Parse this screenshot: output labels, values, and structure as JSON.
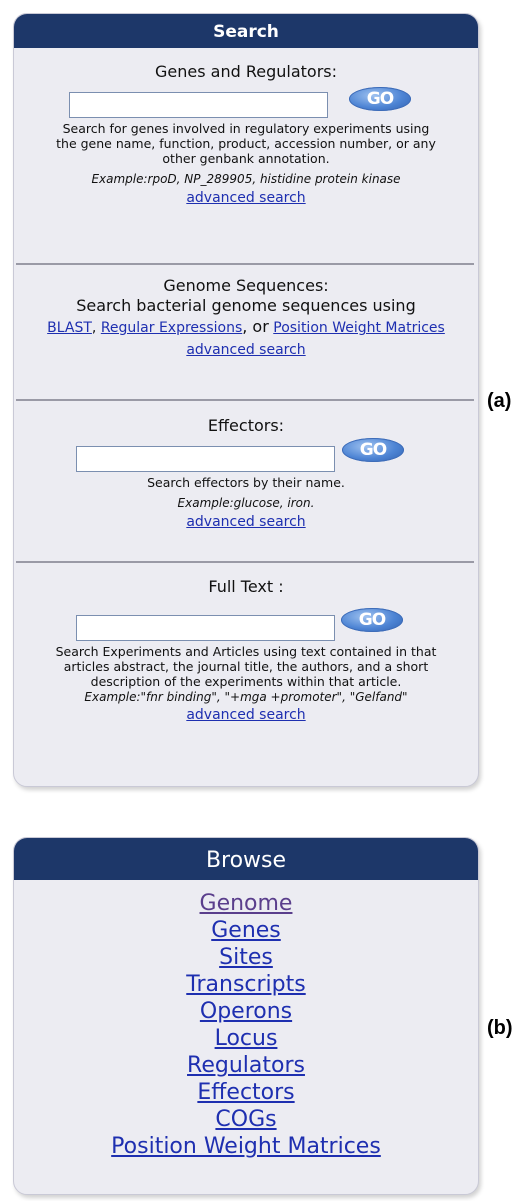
{
  "search": {
    "header": "Search",
    "genes": {
      "title": "Genes and Regulators:",
      "go": "GO",
      "description": "Search for genes involved in regulatory experiments using the gene name, function, product, accession number, or any other genbank annotation.",
      "example": "Example:rpoD, NP_289905, histidine protein kinase",
      "advanced": "advanced search"
    },
    "genome": {
      "title": "Genome Sequences:",
      "intro": "Search bacterial genome sequences using",
      "blast": "BLAST",
      "comma": ",",
      "regex": "Regular Expressions",
      "or": ", or",
      "pwm": "Position Weight Matrices",
      "advanced": "advanced search"
    },
    "effectors": {
      "title": "Effectors:",
      "go": "GO",
      "description": "Search effectors by their name.",
      "example": "Example:glucose, iron.",
      "advanced": "advanced search"
    },
    "fulltext": {
      "title": "Full Text :",
      "go": "GO",
      "description": "Search Experiments and Articles using text contained in that articles abstract, the journal title, the authors, and a short description of the experiments within that article.",
      "example": "Example:\"fnr binding\", \"+mga +promoter\", \"Gelfand\"",
      "advanced": "advanced search"
    }
  },
  "browse": {
    "header": "Browse",
    "items": [
      "Genome",
      "Genes",
      "Sites",
      "Transcripts",
      "Operons",
      "Locus",
      "Regulators",
      "Effectors",
      "COGs",
      "Position Weight Matrices"
    ]
  },
  "labels": {
    "a": "(a)",
    "b": "(b)"
  },
  "colors": {
    "header_bg": "#1d3769",
    "panel_bg": "#ececf2",
    "link": "#1e2fb0",
    "visited_link": "#5a3e8c"
  }
}
